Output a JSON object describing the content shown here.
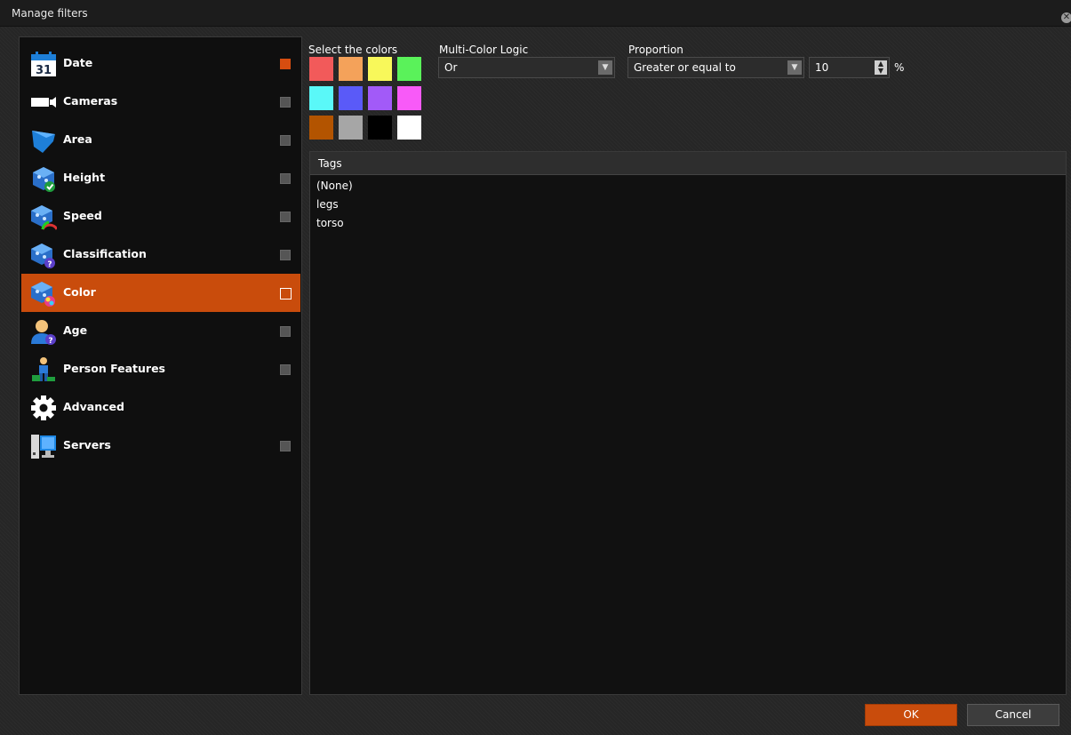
{
  "window": {
    "title": "Manage filters"
  },
  "sidebar": {
    "items": [
      {
        "label": "Date",
        "icon": "calendar-icon",
        "icon_text": "31",
        "check": "orange"
      },
      {
        "label": "Cameras",
        "icon": "camera-icon",
        "check": "gray"
      },
      {
        "label": "Area",
        "icon": "area-icon",
        "check": "gray"
      },
      {
        "label": "Height",
        "icon": "height-icon",
        "check": "gray"
      },
      {
        "label": "Speed",
        "icon": "speed-icon",
        "check": "gray"
      },
      {
        "label": "Classification",
        "icon": "classification-icon",
        "check": "gray"
      },
      {
        "label": "Color",
        "icon": "color-icon",
        "check": "outlined",
        "active": true
      },
      {
        "label": "Age",
        "icon": "age-icon",
        "check": "gray"
      },
      {
        "label": "Person Features",
        "icon": "person-features-icon",
        "check": "gray"
      },
      {
        "label": "Advanced",
        "icon": "gear-icon",
        "check": "none"
      },
      {
        "label": "Servers",
        "icon": "servers-icon",
        "check": "gray"
      }
    ]
  },
  "color_filter": {
    "select_colors_label": "Select the colors",
    "swatches": [
      "#f25a5a",
      "#f4a25a",
      "#f8f85a",
      "#5af25a",
      "#5af8f8",
      "#5a5af8",
      "#a25af8",
      "#f85af8",
      "#b35400",
      "#a6a6a6",
      "#000000",
      "#ffffff"
    ],
    "logic": {
      "label": "Multi-Color Logic",
      "value": "Or"
    },
    "proportion": {
      "label": "Proportion",
      "operator": "Greater or equal to",
      "value": "10",
      "unit": "%"
    }
  },
  "tags": {
    "header": "Tags",
    "items": [
      "(None)",
      "legs",
      "torso"
    ]
  },
  "footer": {
    "ok_label": "OK",
    "cancel_label": "Cancel"
  },
  "colors": {
    "accent": "#c94c0c",
    "background": "#262626",
    "panel": "#111111"
  }
}
